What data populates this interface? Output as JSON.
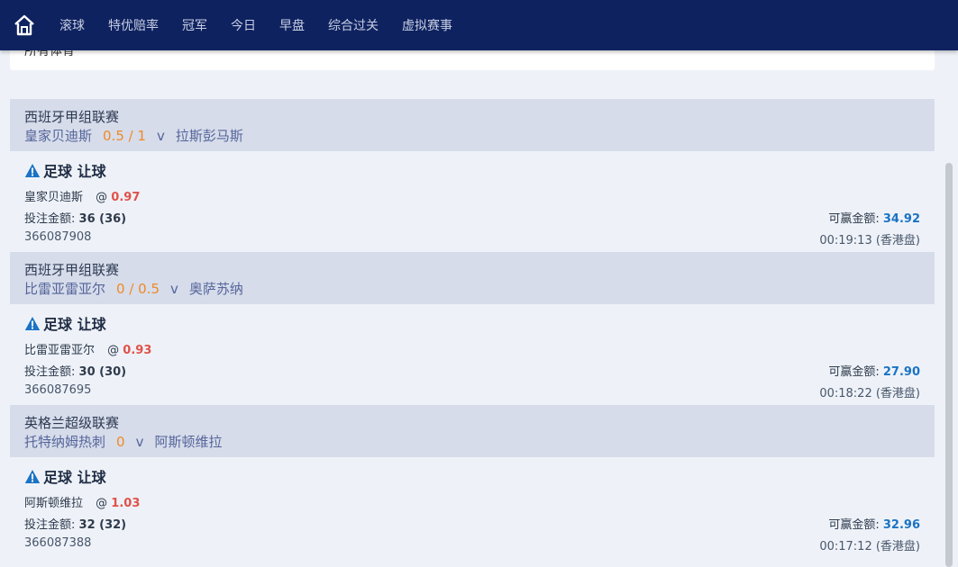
{
  "nav": {
    "home_icon": "home-icon",
    "items": [
      "滚球",
      "特优赔率",
      "冠军",
      "今日",
      "早盘",
      "综合过关",
      "虚拟赛事"
    ]
  },
  "sport_filter": {
    "value": "所有体育",
    "icon": "chevron-down-icon"
  },
  "bets": [
    {
      "league": "西班牙甲组联赛",
      "home": "皇家贝迪斯",
      "handicap": "0.5 / 1",
      "vs": "v",
      "away": "拉斯彭马斯",
      "bet_type": "足球 让球",
      "selection": "皇家贝迪斯",
      "at": "@",
      "odds": "0.97",
      "stake_label": "投注金额:",
      "stake": "36 (36)",
      "win_label": "可赢金额:",
      "win": "34.92",
      "ticket_id": "366087908",
      "time": "00:19:13 (香港盘)"
    },
    {
      "league": "西班牙甲组联赛",
      "home": "比雷亚雷亚尔",
      "handicap": "0 / 0.5",
      "vs": "v",
      "away": "奥萨苏纳",
      "bet_type": "足球 让球",
      "selection": "比雷亚雷亚尔",
      "at": "@",
      "odds": "0.93",
      "stake_label": "投注金额:",
      "stake": "30 (30)",
      "win_label": "可赢金额:",
      "win": "27.90",
      "ticket_id": "366087695",
      "time": "00:18:22 (香港盘)"
    },
    {
      "league": "英格兰超级联赛",
      "home": "托特纳姆热刺",
      "handicap": "0",
      "vs": "v",
      "away": "阿斯顿维拉",
      "bet_type": "足球 让球",
      "selection": "阿斯顿维拉",
      "at": "@",
      "odds": "1.03",
      "stake_label": "投注金额:",
      "stake": "32 (32)",
      "win_label": "可赢金额:",
      "win": "32.96",
      "ticket_id": "366087388",
      "time": "00:17:12 (香港盘)"
    }
  ],
  "colors": {
    "nav_bg": "#0f2260",
    "league_bg": "#d6dcea",
    "handicap": "#f08a24",
    "odds": "#e0524a",
    "win": "#1a73c4",
    "alert_icon": "#1a73c4"
  }
}
